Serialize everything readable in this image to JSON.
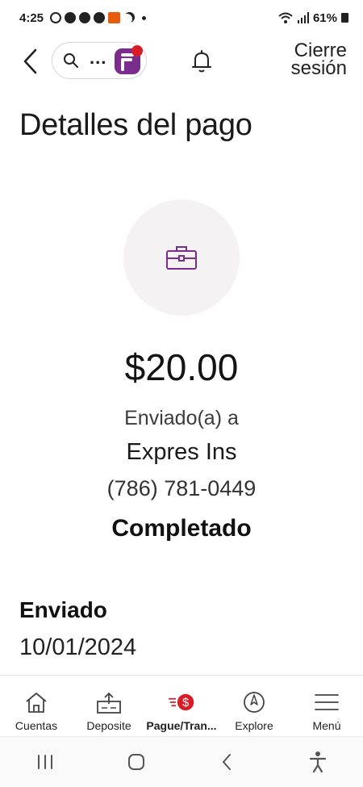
{
  "status_bar": {
    "time": "4:25",
    "battery": "61%",
    "icons": [
      "whatsapp-icon",
      "messenger-icon",
      "messenger-icon",
      "chat-icon",
      "app-icon",
      "moon-icon",
      "dot-icon",
      "wifi-icon",
      "signal-icon",
      "battery-icon"
    ]
  },
  "header": {
    "back_icon": "chevron-left-icon",
    "search_icon": "search-icon",
    "search_ellipsis": "...",
    "bell_icon": "bell-icon",
    "logout_line1": "Cierre",
    "logout_line2": "sesión"
  },
  "page": {
    "title": "Detalles del pago",
    "payment_icon": "briefcase-icon",
    "amount": "$20.00",
    "sent_to_label": "Enviado(a) a",
    "recipient": "Expres Ins",
    "phone": "(786) 781-0449",
    "status": "Completado"
  },
  "details": {
    "sent_label": "Enviado",
    "sent_date": "10/01/2024"
  },
  "bottom_nav": {
    "items": [
      {
        "label": "Cuentas",
        "icon": "house-icon"
      },
      {
        "label": "Deposite",
        "icon": "deposit-icon"
      },
      {
        "label": "Pague/Tran...",
        "icon": "pay-transfer-icon"
      },
      {
        "label": "Explore",
        "icon": "compass-icon"
      },
      {
        "label": "Menú",
        "icon": "hamburger-menu-icon"
      }
    ],
    "active_index": 2
  },
  "colors": {
    "accent_purple": "#7b2d8e",
    "accent_red": "#d71e28",
    "circle_bg": "#f4f2f2"
  }
}
